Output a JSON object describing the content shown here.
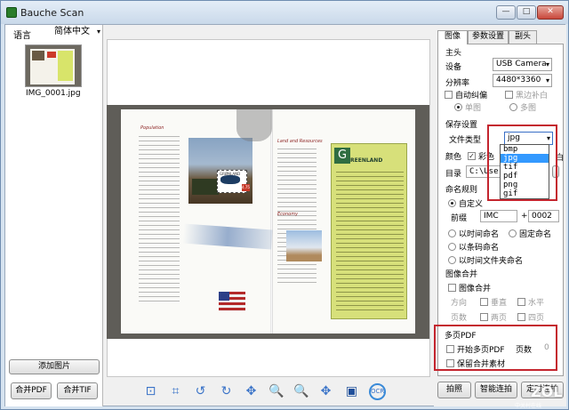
{
  "window": {
    "title": "Bauche Scan",
    "minimize": "—",
    "maximize": "□",
    "close": "✕"
  },
  "left_panel": {
    "language_label": "语言",
    "language_value": "简体中文",
    "thumbnail_caption": "IMG_0001.jpg",
    "add_image_button": "添加图片",
    "merge_pdf_button": "合并PDF",
    "merge_tif_button": "合并TIF"
  },
  "preview": {
    "magazine_headline": "REENLAND",
    "left_col_heading_1": "Population",
    "left_col_heading_2": "Economy",
    "mid_heading": "Land and Resources",
    "stamp_text": "GRØNLAND",
    "stamp_value": "4.75"
  },
  "toolbar": {
    "icons": [
      "select-icon",
      "crop-icon",
      "rotate-left-icon",
      "rotate-right-icon",
      "move-icon",
      "zoom-out-icon",
      "zoom-in-icon",
      "fit-icon",
      "film-icon",
      "ocr-icon"
    ]
  },
  "right_panel": {
    "tabs": [
      "图像",
      "参数设置",
      "副头"
    ],
    "main_camera_label": "主头",
    "device_label": "设备",
    "device_value": "USB Camera",
    "resolution_label": "分辨率",
    "resolution_value": "4480*3360",
    "auto_deskew_label": "自动纠偏",
    "black_fill_label": "黑边补白",
    "single_label": "单图",
    "multi_label": "多图",
    "save_settings_label": "保存设置",
    "file_type_label": "文件类型",
    "file_type_value": "jpg",
    "file_type_options": [
      "bmp",
      "jpg",
      "tif",
      "pdf",
      "png",
      "gif"
    ],
    "color_label": "颜色",
    "color_mode_label": "彩色",
    "color_trailing": "白",
    "directory_label": "目录",
    "directory_value": "C:\\Users",
    "naming_rule_label": "命名规则",
    "custom_label": "自定义",
    "prefix_label": "前缀",
    "prefix_value": "IMC",
    "plus_sign": "+",
    "counter_value": "0002",
    "time_naming_label": "以时间命名",
    "fixed_naming_label": "固定命名",
    "barcode_naming_label": "以条码命名",
    "time_folder_naming_label": "以时间文件夹命名",
    "image_merge_section": "图像合并",
    "image_merge_checkbox": "图像合并",
    "direction_label": "方向",
    "vertical_label": "垂直",
    "horizontal_label": "水平",
    "page_count_label": "页数",
    "two_pages_label": "两页",
    "four_pages_label": "四页",
    "multi_pdf_section": "多页PDF",
    "start_multi_pdf_label": "开始多页PDF",
    "pages_label": "页数",
    "pages_value": "0",
    "keep_merge_material_label": "保留合并素材",
    "capture_button": "拍照",
    "smart_capture_button": "智能连拍",
    "timed_capture_button": "定时连拍"
  },
  "watermark": {
    "logo": "ZOL",
    "sub": "中关村在线"
  }
}
